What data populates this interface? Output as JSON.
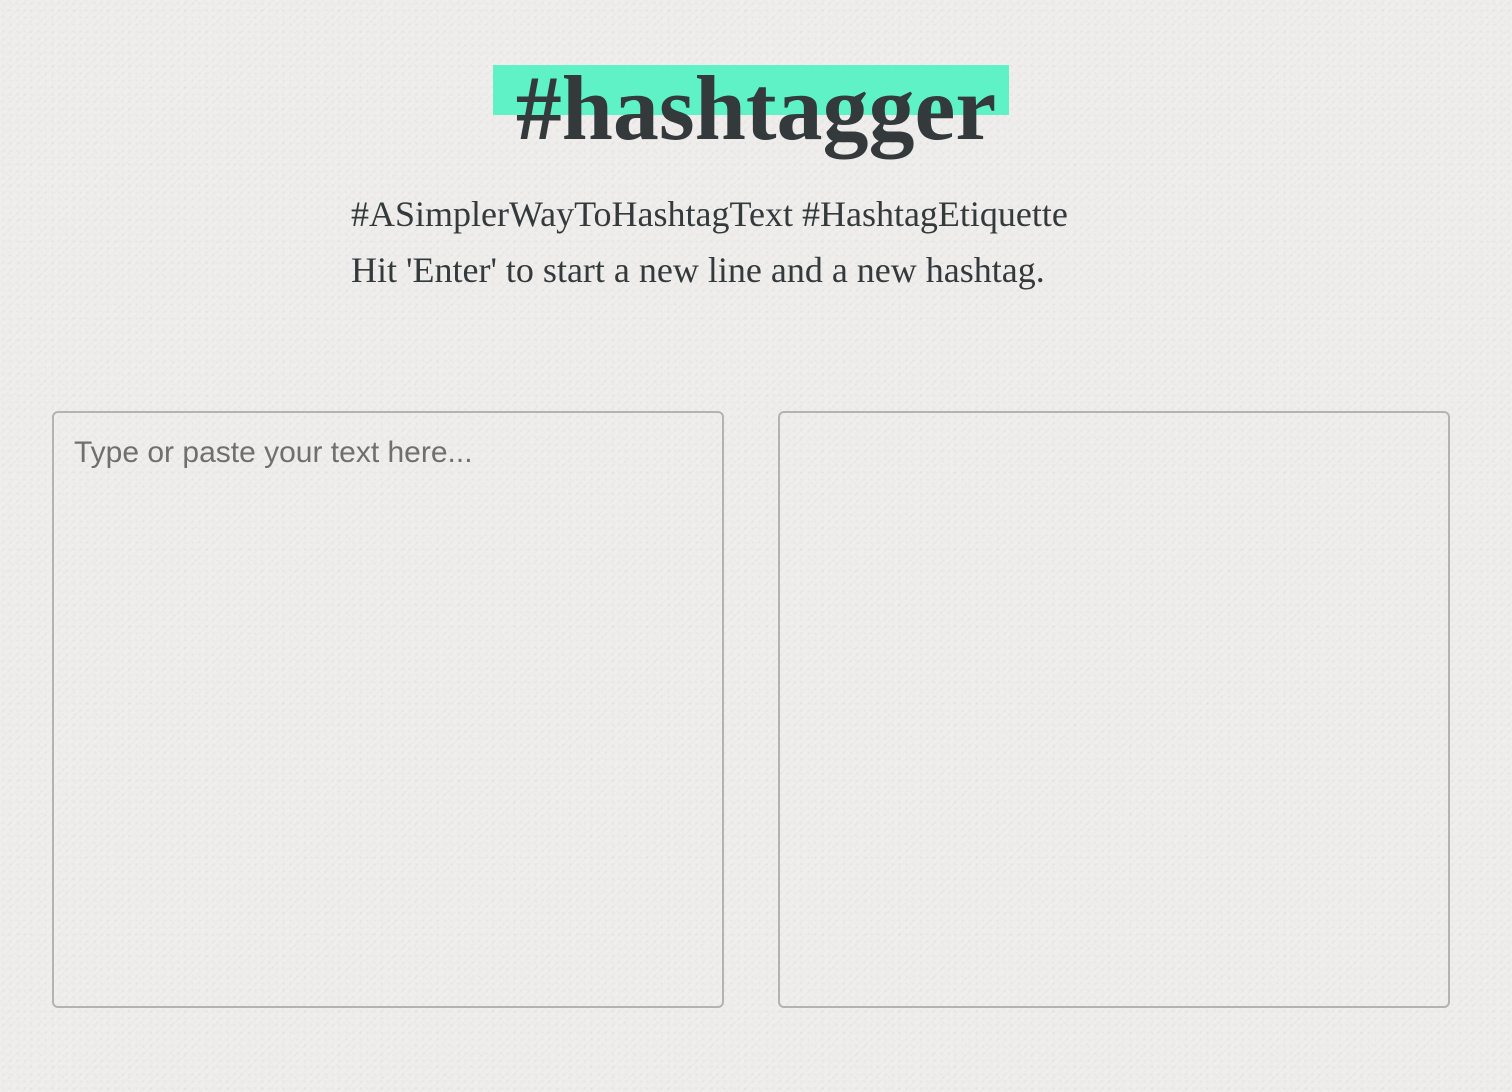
{
  "header": {
    "title": "#hashtagger",
    "subtitle_line1": "#ASimplerWayToHashtagText #HashtagEtiquette",
    "subtitle_line2": "Hit 'Enter' to start a new line and a new hashtag."
  },
  "editor": {
    "input_placeholder": "Type or paste your text here...",
    "input_value": "",
    "output_value": ""
  },
  "colors": {
    "accent_highlight": "#5ef2c6",
    "text": "#34393c",
    "border": "#b3b3b1",
    "background": "#efeeec"
  }
}
